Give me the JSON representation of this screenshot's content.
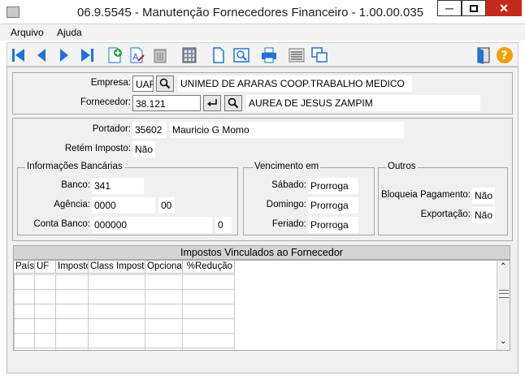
{
  "window": {
    "title": "06.9.5545 - Manutenção Fornecedores Financeiro - 1.00.00.035"
  },
  "menu": {
    "items": [
      "Arquivo",
      "Ajuda"
    ]
  },
  "toolbar": {
    "icons": [
      "first-record-icon",
      "prev-record-icon",
      "next-record-icon",
      "last-record-icon",
      "new-record-icon",
      "edit-record-icon",
      "delete-record-icon",
      "calculator-icon",
      "document-icon",
      "preview-icon",
      "print-icon",
      "list-icon",
      "window-icon",
      "exit-door-icon",
      "help-icon"
    ]
  },
  "form": {
    "empresa_label": "Empresa:",
    "empresa_code": "UAR",
    "empresa_name": "UNIMED DE ARARAS COOP.TRABALHO MEDICO",
    "fornecedor_label": "Fornecedor:",
    "fornecedor_code": "38.121",
    "fornecedor_name": "AUREA DE JESUS ZAMPIM",
    "portador_label": "Portador:",
    "portador_code": "35602",
    "portador_name": "Mauricio G Momo",
    "retem_label": "Retém Imposto:",
    "retem_value": "Não"
  },
  "bancarias": {
    "legend": "Informações Bancárias",
    "banco_label": "Banco:",
    "banco_value": "341",
    "agencia_label": "Agência:",
    "agencia_value": "0000",
    "agencia_dv": "00",
    "conta_label": "Conta Banco:",
    "conta_value": "000000",
    "conta_dv": "0"
  },
  "vencimento": {
    "legend": "Vencimento em",
    "sabado_label": "Sábado:",
    "sabado_value": "Prorroga",
    "domingo_label": "Domingo:",
    "domingo_value": "Prorroga",
    "feriado_label": "Feriado:",
    "feriado_value": "Prorroga"
  },
  "outros": {
    "legend": "Outros",
    "bloqueia_label": "Bloqueia Pagamento:",
    "bloqueia_value": "Não",
    "exportacao_label": "Exportação:",
    "exportacao_value": "Não"
  },
  "grid": {
    "title": "Impostos Vinculados ao Fornecedor",
    "columns": [
      "País",
      "UF",
      "Imposto",
      "Class Imposto",
      "Opcional",
      "%Redução"
    ]
  },
  "colors": {
    "close_red": "#c42b1c",
    "toolbar_blue": "#1e73d8",
    "help_orange": "#f0a000"
  }
}
